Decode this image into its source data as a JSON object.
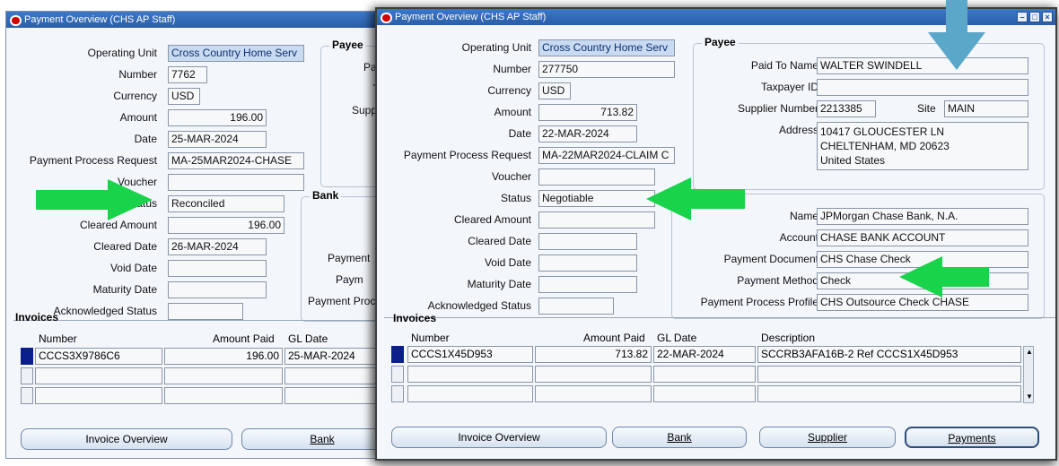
{
  "left_window": {
    "title": "Payment Overview (CHS AP Staff)",
    "labels": {
      "operating_unit": "Operating Unit",
      "number": "Number",
      "currency": "Currency",
      "amount": "Amount",
      "date": "Date",
      "ppr": "Payment Process Request",
      "voucher": "Voucher",
      "status": "Status",
      "cleared_amount": "Cleared Amount",
      "cleared_date": "Cleared Date",
      "void_date": "Void Date",
      "maturity_date": "Maturity Date",
      "ack_status": "Acknowledged Status"
    },
    "values": {
      "operating_unit": "Cross Country Home Serv",
      "number": "7762",
      "currency": "USD",
      "amount": "196.00",
      "date": "25-MAR-2024",
      "ppr": "MA-25MAR2024-CHASE",
      "voucher": "",
      "status": "Reconciled",
      "cleared_amount": "196.00",
      "cleared_date": "26-MAR-2024",
      "void_date": "",
      "maturity_date": "",
      "ack_status": ""
    },
    "payee": {
      "heading": "Payee",
      "partial_labels": [
        "Pa",
        "T",
        "Supp"
      ]
    },
    "bank": {
      "heading": "Bank",
      "partial_labels": [
        "Payment",
        "Paym",
        "Payment Proc"
      ]
    },
    "invoices": {
      "heading": "Invoices",
      "columns": {
        "number": "Number",
        "amount_paid": "Amount Paid",
        "gl_date": "GL Date"
      },
      "rows": [
        {
          "number": "CCCS3X9786C6",
          "amount_paid": "196.00",
          "gl_date": "25-MAR-2024"
        },
        {
          "number": "",
          "amount_paid": "",
          "gl_date": ""
        },
        {
          "number": "",
          "amount_paid": "",
          "gl_date": ""
        }
      ]
    },
    "buttons": {
      "invoice_overview": "Invoice Overview",
      "bank": "Bank"
    }
  },
  "right_window": {
    "title": "Payment Overview (CHS AP Staff)",
    "labels": {
      "operating_unit": "Operating Unit",
      "number": "Number",
      "currency": "Currency",
      "amount": "Amount",
      "date": "Date",
      "ppr": "Payment Process Request",
      "voucher": "Voucher",
      "status": "Status",
      "cleared_amount": "Cleared Amount",
      "cleared_date": "Cleared Date",
      "void_date": "Void Date",
      "maturity_date": "Maturity Date",
      "ack_status": "Acknowledged Status"
    },
    "values": {
      "operating_unit": "Cross Country Home Serv",
      "number": "277750",
      "currency": "USD",
      "amount": "713.82",
      "date": "22-MAR-2024",
      "ppr": "MA-22MAR2024-CLAIM C",
      "voucher": "",
      "status": "Negotiable",
      "cleared_amount": "",
      "cleared_date": "",
      "void_date": "",
      "maturity_date": "",
      "ack_status": ""
    },
    "payee": {
      "heading": "Payee",
      "labels": {
        "paid_to": "Paid To Name",
        "taxpayer": "Taxpayer ID",
        "supplier_number": "Supplier Number",
        "site": "Site",
        "address": "Address"
      },
      "values": {
        "paid_to": "WALTER SWINDELL",
        "taxpayer": "",
        "supplier_number": "2213385",
        "site": "MAIN",
        "address": [
          "10417 GLOUCESTER LN",
          "CHELTENHAM, MD 20623",
          "United States"
        ]
      }
    },
    "bank": {
      "labels": {
        "name": "Name",
        "account": "Account",
        "payment_document": "Payment Document",
        "payment_method": "Payment Method",
        "ppp": "Payment Process Profile"
      },
      "values": {
        "name": "JPMorgan Chase Bank, N.A.",
        "account": "CHASE BANK ACCOUNT",
        "payment_document": "CHS Chase Check",
        "payment_method": "Check",
        "ppp": "CHS Outsource Check CHASE"
      }
    },
    "invoices": {
      "heading": "Invoices",
      "columns": {
        "number": "Number",
        "amount_paid": "Amount Paid",
        "gl_date": "GL Date",
        "description": "Description"
      },
      "rows": [
        {
          "number": "CCCS1X45D953",
          "amount_paid": "713.82",
          "gl_date": "22-MAR-2024",
          "description": "SCCRB3AFA16B-2 Ref CCCS1X45D953"
        },
        {
          "number": "",
          "amount_paid": "",
          "gl_date": "",
          "description": ""
        },
        {
          "number": "",
          "amount_paid": "",
          "gl_date": "",
          "description": ""
        }
      ]
    },
    "buttons": {
      "invoice_overview": "Invoice Overview",
      "bank": "Bank",
      "supplier": "Supplier",
      "payments": "Payments"
    }
  },
  "colors": {
    "arrow_green": "#19d34a",
    "arrow_blue": "#5aa7c9",
    "title_blue": "#2a5ea8"
  }
}
